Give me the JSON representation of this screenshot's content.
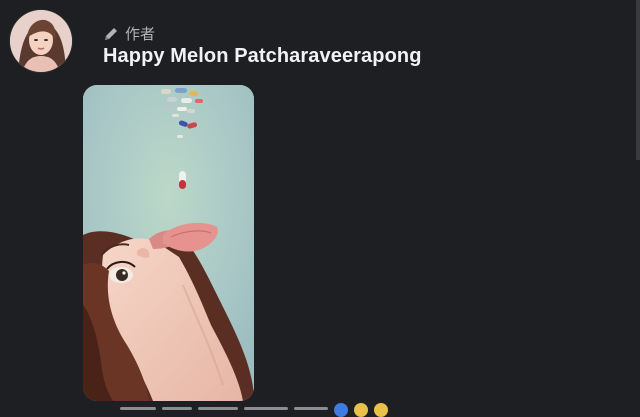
{
  "post": {
    "author_badge": "作者",
    "author_name": "Happy Melon Patcharaveerapong",
    "icons": {
      "badge": "pencil-icon",
      "avatar": "profile-photo",
      "image": "illustration-pills-falling-into-mouth"
    },
    "colors": {
      "background": "#1e1f22",
      "name": "#f0f2f5",
      "badge": "#b0b3b8"
    }
  }
}
